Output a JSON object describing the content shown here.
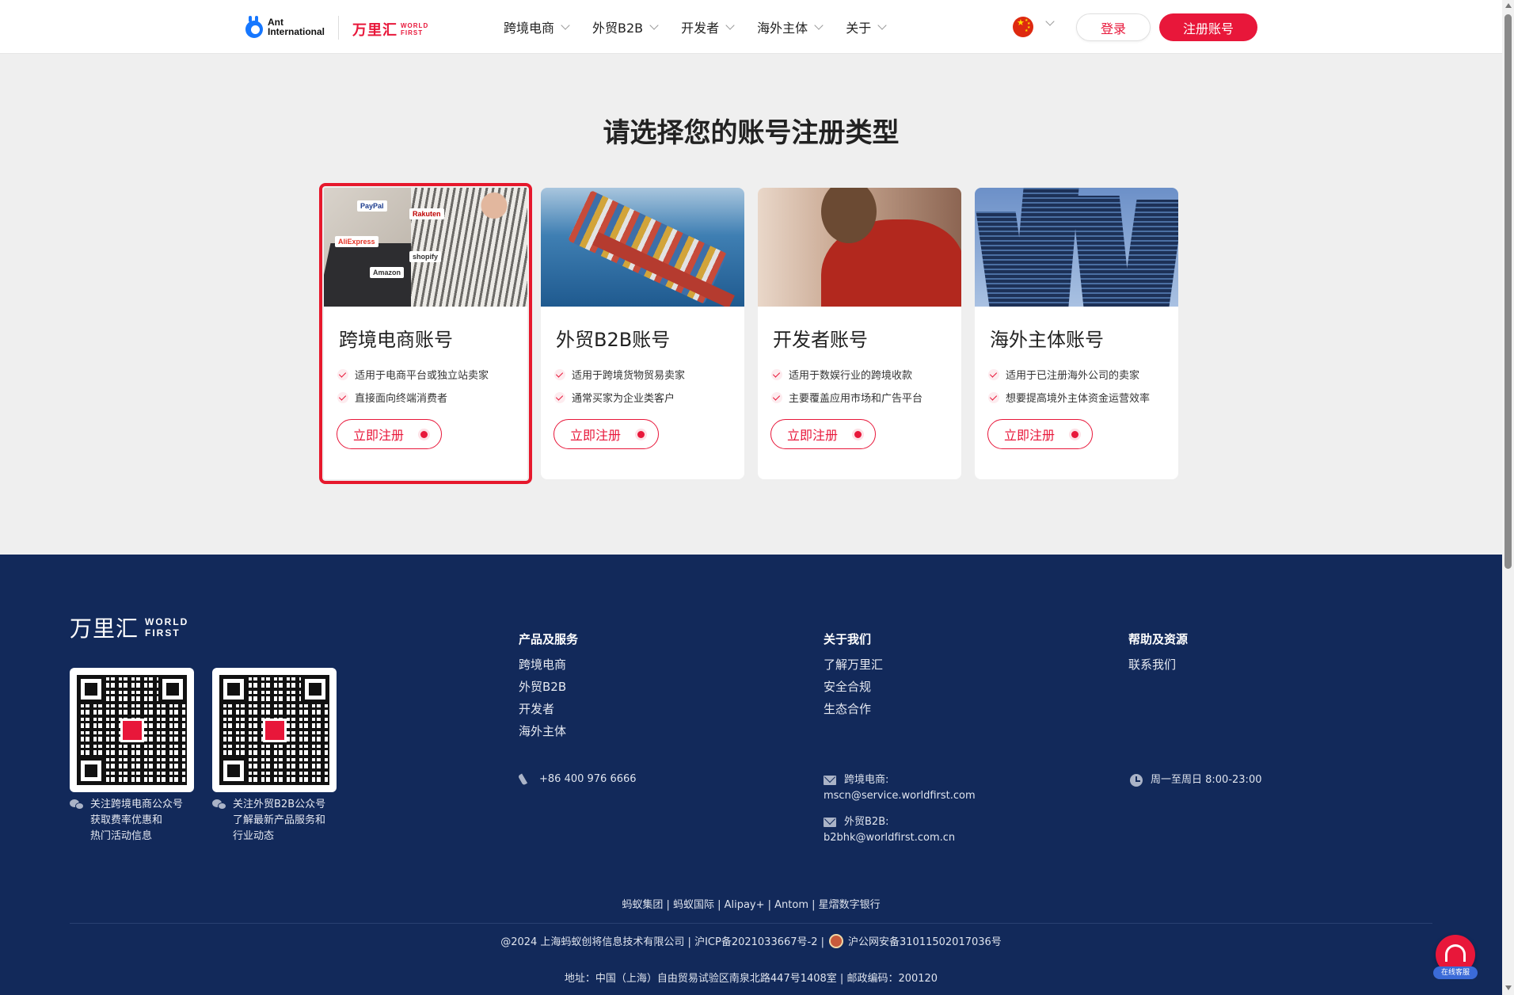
{
  "header": {
    "ant_logo": {
      "line1": "Ant",
      "line2": "International"
    },
    "wf_logo": {
      "cn": "万里汇",
      "en_line1": "WORLD",
      "en_line2": "FIRST"
    },
    "nav": [
      {
        "label": "跨境电商"
      },
      {
        "label": "外贸B2B"
      },
      {
        "label": "开发者"
      },
      {
        "label": "海外主体"
      },
      {
        "label": "关于"
      }
    ],
    "language_icon": "china-flag-icon",
    "login_label": "登录",
    "register_label": "注册账号"
  },
  "main": {
    "title": "请选择您的账号注册类型",
    "cards": [
      {
        "title": "跨境电商账号",
        "features": [
          "适用于电商平台或独立站卖家",
          "直接面向终端消费者"
        ],
        "button": "立即注册",
        "image_tags": [
          "PayPal",
          "Rakuten",
          "AliExpress",
          "shopify",
          "Amazon"
        ],
        "selected": true
      },
      {
        "title": "外贸B2B账号",
        "features": [
          "适用于跨境货物贸易卖家",
          "通常买家为企业类客户"
        ],
        "button": "立即注册",
        "selected": false
      },
      {
        "title": "开发者账号",
        "features": [
          "适用于数娱行业的跨境收款",
          "主要覆盖应用市场和广告平台"
        ],
        "button": "立即注册",
        "selected": false
      },
      {
        "title": "海外主体账号",
        "features": [
          "适用于已注册海外公司的卖家",
          "想要提高境外主体资金运营效率"
        ],
        "button": "立即注册",
        "selected": false
      }
    ]
  },
  "footer": {
    "logo": {
      "cn": "万里汇",
      "en_line1": "WORLD",
      "en_line2": "FIRST"
    },
    "qr": [
      {
        "caption": [
          "关注跨境电商公众号",
          "获取费率优惠和",
          "热门活动信息"
        ]
      },
      {
        "caption": [
          "关注外贸B2B公众号",
          "了解最新产品服务和",
          "行业动态"
        ]
      }
    ],
    "columns": [
      {
        "heading": "产品及服务",
        "links": [
          "跨境电商",
          "外贸B2B",
          "开发者",
          "海外主体"
        ]
      },
      {
        "heading": "关于我们",
        "links": [
          "了解万里汇",
          "安全合规",
          "生态合作"
        ]
      },
      {
        "heading": "帮助及资源",
        "links": [
          "联系我们"
        ]
      }
    ],
    "phone": "+86 400 976 6666",
    "email_ec_label": "跨境电商:",
    "email_ec": "mscn@service.worldfirst.com",
    "email_b2b_label": "外贸B2B:",
    "email_b2b": "b2bhk@worldfirst.com.cn",
    "hours": "周一至周日 8:00-23:00",
    "group_links": "蚂蚁集团 | 蚂蚁国际 | Alipay+ | Antom | 星熠数字银行",
    "copyright": "@2024 上海蚂蚁创将信息技术有限公司 | 沪ICP备2021033667号-2 |",
    "police": "沪公网安备31011502017036号",
    "address": "地址：中国（上海）自由贸易试验区南泉北路447号1408室 | 邮政编码：200120",
    "support_label": "在线客服"
  }
}
